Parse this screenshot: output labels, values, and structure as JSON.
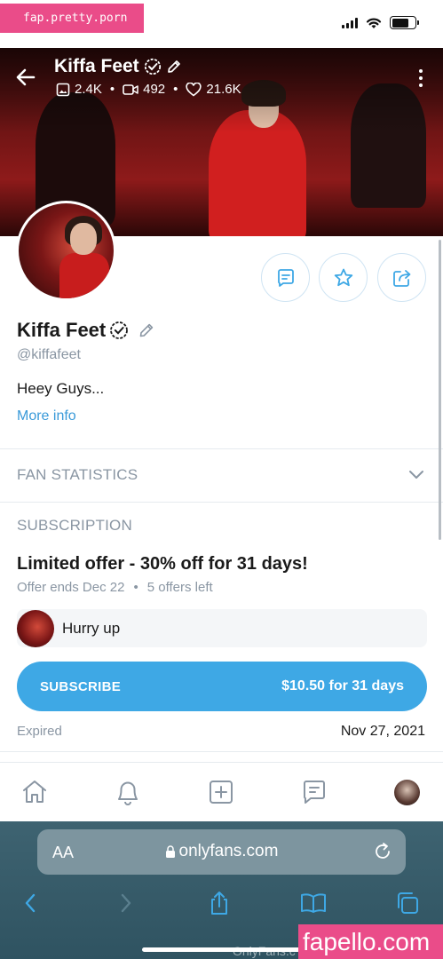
{
  "watermark_top": "fap.pretty.porn",
  "watermark_bottom": "fapello.com",
  "watermark_bottom_faint": "OnlyFans.c",
  "colors": {
    "accent": "#3ea8e5",
    "muted": "#8a96a3",
    "watermark": "#ea4c89"
  },
  "cover": {
    "name": "Kiffa Feet",
    "stats": [
      {
        "icon": "image-icon",
        "value": "2.4K"
      },
      {
        "icon": "video-icon",
        "value": "492"
      },
      {
        "icon": "heart-icon",
        "value": "21.6K"
      }
    ]
  },
  "profile": {
    "name": "Kiffa Feet",
    "username": "@kiffafeet",
    "bio": "Heey Guys...",
    "more_info": "More info"
  },
  "sections": {
    "fan_statistics": "FAN STATISTICS",
    "subscription": "SUBSCRIPTION"
  },
  "offer": {
    "title": "Limited offer - 30% off for 31 days!",
    "ends": "Offer ends Dec 22",
    "left": "5 offers left",
    "promo_text": "Hurry up",
    "subscribe_label": "SUBSCRIBE",
    "price": "$10.50 for 31 days",
    "expired_label": "Expired",
    "expired_date": "Nov 27, 2021"
  },
  "bottom_nav": [
    "home-icon",
    "bell-icon",
    "add-post-icon",
    "messages-icon",
    "profile-avatar"
  ],
  "browser": {
    "aa_label": "AA",
    "url": "onlyfans.com"
  }
}
